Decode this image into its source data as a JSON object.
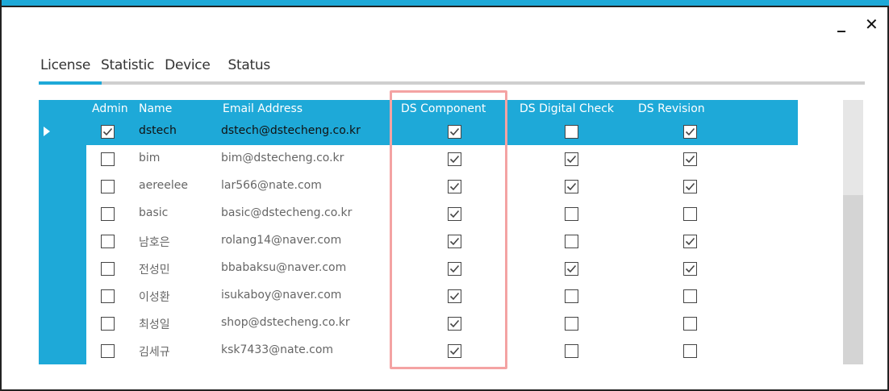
{
  "window": {
    "minimize_label": "_",
    "close_label": "✕"
  },
  "tabs": [
    {
      "label": "License"
    },
    {
      "label": "Statistic"
    },
    {
      "label": "Device"
    },
    {
      "label": "Status"
    }
  ],
  "columns": {
    "admin": "Admin",
    "name": "Name",
    "email": "Email Address",
    "ds_component": "DS Component",
    "ds_digital_check": "DS Digital Check",
    "ds_revision": "DS Revision"
  },
  "rows": [
    {
      "name": "dstech",
      "email": "dstech@dstecheng.co.kr",
      "admin": true,
      "ds_component": true,
      "ds_digital_check": false,
      "ds_revision": true,
      "selected": true
    },
    {
      "name": "bim",
      "email": "bim@dstecheng.co.kr",
      "admin": false,
      "ds_component": true,
      "ds_digital_check": true,
      "ds_revision": true
    },
    {
      "name": "aereelee",
      "email": "lar566@nate.com",
      "admin": false,
      "ds_component": true,
      "ds_digital_check": true,
      "ds_revision": true
    },
    {
      "name": "basic",
      "email": "basic@dstecheng.co.kr",
      "admin": false,
      "ds_component": true,
      "ds_digital_check": false,
      "ds_revision": false
    },
    {
      "name": "남호은",
      "email": "rolang14@naver.com",
      "admin": false,
      "ds_component": true,
      "ds_digital_check": false,
      "ds_revision": true
    },
    {
      "name": "전성민",
      "email": "bbabaksu@naver.com",
      "admin": false,
      "ds_component": true,
      "ds_digital_check": true,
      "ds_revision": true
    },
    {
      "name": "이성환",
      "email": "isukaboy@naver.com",
      "admin": false,
      "ds_component": true,
      "ds_digital_check": false,
      "ds_revision": false
    },
    {
      "name": "최성일",
      "email": "shop@dstecheng.co.kr",
      "admin": false,
      "ds_component": true,
      "ds_digital_check": false,
      "ds_revision": false
    },
    {
      "name": "김세규",
      "email": "ksk7433@nate.com",
      "admin": false,
      "ds_component": true,
      "ds_digital_check": false,
      "ds_revision": false
    }
  ],
  "colors": {
    "accent": "#1ea9d8",
    "highlight_box": "#f4a3a3"
  }
}
